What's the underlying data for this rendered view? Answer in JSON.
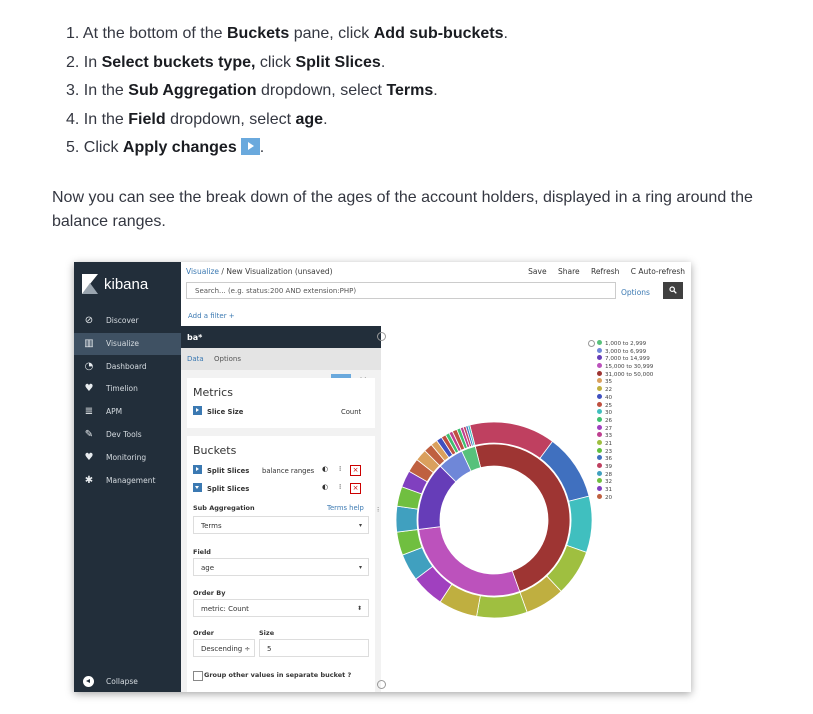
{
  "steps": [
    {
      "n": "1. ",
      "parts": [
        {
          "t": "At the bottom of the "
        },
        {
          "t": "Buckets",
          "b": true
        },
        {
          "t": " pane, click "
        },
        {
          "t": "Add sub-buckets",
          "b": true
        },
        {
          "t": "."
        }
      ]
    },
    {
      "n": "2. ",
      "parts": [
        {
          "t": "In "
        },
        {
          "t": "Select buckets type,",
          "b": true
        },
        {
          "t": " click "
        },
        {
          "t": "Split Slices",
          "b": true
        },
        {
          "t": "."
        }
      ]
    },
    {
      "n": "3. ",
      "parts": [
        {
          "t": "In the "
        },
        {
          "t": "Sub Aggregation",
          "b": true
        },
        {
          "t": " dropdown, select "
        },
        {
          "t": "Terms",
          "b": true
        },
        {
          "t": "."
        }
      ]
    },
    {
      "n": "4. ",
      "parts": [
        {
          "t": "In the "
        },
        {
          "t": "Field",
          "b": true
        },
        {
          "t": " dropdown, select "
        },
        {
          "t": "age",
          "b": true
        },
        {
          "t": "."
        }
      ]
    },
    {
      "n": "5. ",
      "parts": [
        {
          "t": "Click "
        },
        {
          "t": "Apply changes",
          "b": true
        },
        {
          "t": "",
          "btn": true
        },
        {
          "t": "."
        }
      ]
    }
  ],
  "paragraph": "Now you can see the break down of the ages of the account holders, displayed in a ring around the balance ranges.",
  "kibana": {
    "logo": "kibana",
    "nav": [
      {
        "label": "Discover",
        "icon": "compass-icon",
        "glyph": "⊘"
      },
      {
        "label": "Visualize",
        "icon": "bar-chart-icon",
        "glyph": "▥"
      },
      {
        "label": "Dashboard",
        "icon": "dashboard-icon",
        "glyph": "◔"
      },
      {
        "label": "Timelion",
        "icon": "timelion-icon",
        "glyph": "♥"
      },
      {
        "label": "APM",
        "icon": "apm-icon",
        "glyph": "≣"
      },
      {
        "label": "Dev Tools",
        "icon": "wrench-icon",
        "glyph": "✎"
      },
      {
        "label": "Monitoring",
        "icon": "heartbeat-icon",
        "glyph": "♥"
      },
      {
        "label": "Management",
        "icon": "gear-icon",
        "glyph": "✱"
      }
    ],
    "collapse": "Collapse",
    "breadcrumb_link": "Visualize",
    "breadcrumb_sep": " / ",
    "breadcrumb_current": "New Visualization (unsaved)",
    "menu": [
      "Save",
      "Share",
      "Refresh",
      "C Auto-refresh"
    ],
    "search_placeholder": "Search... (e.g. status:200 AND extension:PHP)",
    "options": "Options",
    "add_filter": "Add a filter +",
    "editor_title": "ba*",
    "tab_data": "Data",
    "tab_options": "Options",
    "metrics_title": "Metrics",
    "metric_label": "Slice Size",
    "metric_value": "Count",
    "buckets_title": "Buckets",
    "bucket1_label": "Split Slices",
    "bucket1_value": "balance ranges",
    "bucket2_label": "Split Slices",
    "sub_agg_label": "Sub Aggregation",
    "terms_help": "Terms help",
    "sub_agg_value": "Terms",
    "field_label": "Field",
    "field_value": "age",
    "order_by_label": "Order By",
    "order_by_value": "metric: Count",
    "order_label": "Order",
    "size_label": "Size",
    "order_value": "Descending ÷",
    "size_value": "5",
    "group_other": "Group other values in separate bucket ?"
  },
  "chart_data": {
    "type": "pie",
    "legend": [
      {
        "label": "1,000 to 2,999",
        "color": "#57c17b"
      },
      {
        "label": "3,000 to 6,999",
        "color": "#6f87d8"
      },
      {
        "label": "7,000 to 14,999",
        "color": "#663db8"
      },
      {
        "label": "15,000 to 30,999",
        "color": "#bc52bc"
      },
      {
        "label": "31,000 to 50,000",
        "color": "#9e3533"
      },
      {
        "label": "35",
        "color": "#daa05d"
      },
      {
        "label": "22",
        "color": "#bfaf40"
      },
      {
        "label": "40",
        "color": "#4050bf"
      },
      {
        "label": "25",
        "color": "#bf5040"
      },
      {
        "label": "30",
        "color": "#40bfbf"
      },
      {
        "label": "26",
        "color": "#40bf70"
      },
      {
        "label": "27",
        "color": "#a040bf"
      },
      {
        "label": "33",
        "color": "#bf4090"
      },
      {
        "label": "21",
        "color": "#9fbf40"
      },
      {
        "label": "23",
        "color": "#60bf40"
      },
      {
        "label": "36",
        "color": "#4070bf"
      },
      {
        "label": "39",
        "color": "#bf4060"
      },
      {
        "label": "28",
        "color": "#40a0bf"
      },
      {
        "label": "32",
        "color": "#70bf40"
      },
      {
        "label": "31",
        "color": "#8040bf"
      },
      {
        "label": "20",
        "color": "#bf6040"
      }
    ],
    "inner": [
      {
        "label": "31,000 to 50,000",
        "value": 0.485,
        "color": "#9e3533"
      },
      {
        "label": "15,000 to 30,999",
        "value": 0.285,
        "color": "#bc52bc"
      },
      {
        "label": "7,000 to 14,999",
        "value": 0.145,
        "color": "#663db8"
      },
      {
        "label": "3,000 to 6,999",
        "value": 0.055,
        "color": "#6f87d8"
      },
      {
        "label": "1,000 to 2,999",
        "value": 0.03,
        "color": "#57c17b"
      }
    ],
    "outer_colors": [
      "#bf4060",
      "#4070bf",
      "#40bfbf",
      "#9fbf40",
      "#bfaf40",
      "#a040bf",
      "#40a0bf",
      "#70bf40",
      "#8040bf",
      "#bf6040",
      "#daa05d",
      "#4050bf",
      "#bf5040",
      "#40bf70",
      "#bf4090"
    ]
  }
}
